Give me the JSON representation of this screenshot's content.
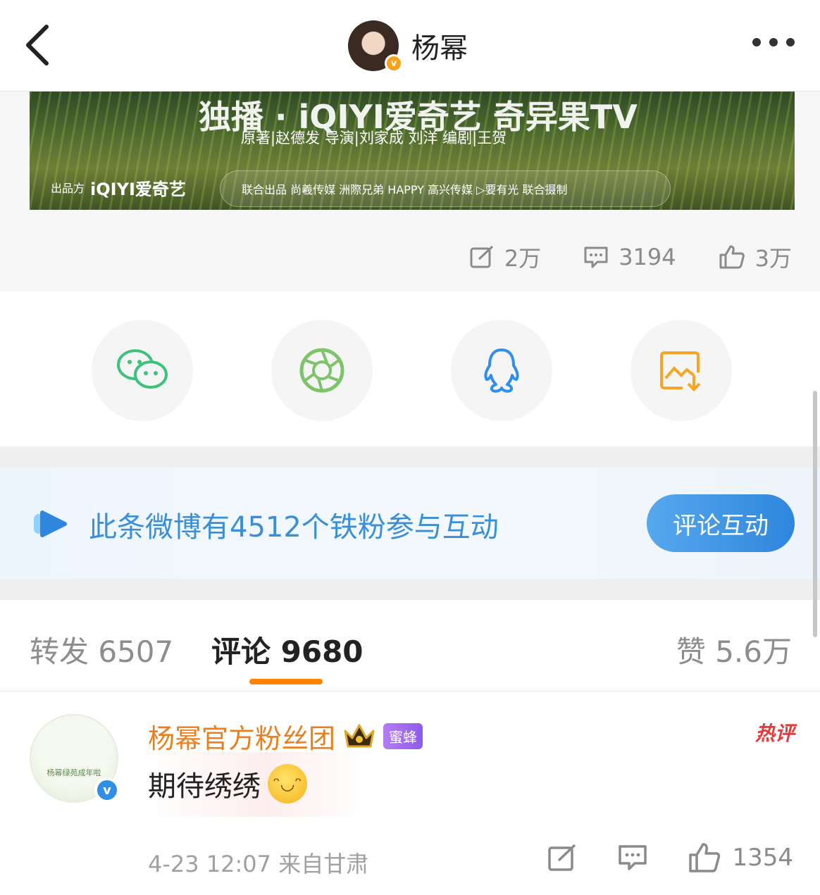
{
  "header": {
    "title": "杨幂"
  },
  "banner": {
    "brand": "独播 · iQIYI爱奇艺  奇异果TV",
    "credits": "原著|赵德发   导演|刘家成 刘洋   编剧|王贺",
    "producer_label": "出品方",
    "producer_logo": "iQIYI爱奇艺",
    "co_producers": "联合出品  尚羲传媒  洲際兄弟  HAPPY 高兴传媒  ▷要有光   联合摄制"
  },
  "stats": {
    "repost": "2万",
    "comment": "3194",
    "like": "3万"
  },
  "share": {
    "items": [
      "wechat-icon",
      "moments-icon",
      "qq-icon",
      "save-image-icon"
    ]
  },
  "fan_banner": {
    "text": "此条微博有4512个铁粉参与互动",
    "button": "评论互动"
  },
  "tabs": {
    "repost": "转发 6507",
    "comments": "评论 9680",
    "likes": "赞 5.6万"
  },
  "comment": {
    "avatar_text": "杨幂绿苑成年啦",
    "username": "杨幂官方粉丝团",
    "badge": "蜜蜂",
    "hot_tag": "热评",
    "text": "期待绣绣",
    "meta": "4-23 12:07  来自甘肃",
    "likes": "1354"
  },
  "colors": {
    "accent_orange": "#ff8200",
    "link_blue": "#3a8fd6",
    "wechat_green": "#3cc27a",
    "qq_blue": "#2e8ee8",
    "save_orange": "#f6a623"
  }
}
